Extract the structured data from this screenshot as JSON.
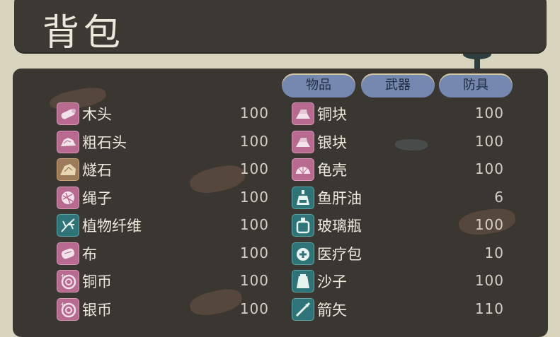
{
  "title": "背包",
  "tabs": [
    {
      "label": "物品"
    },
    {
      "label": "武器"
    },
    {
      "label": "防具"
    }
  ],
  "inventory": {
    "left": [
      {
        "name": "木头",
        "qty": "100",
        "icon": "log-icon",
        "color": "pink"
      },
      {
        "name": "粗石头",
        "qty": "100",
        "icon": "rough-stone-icon",
        "color": "pink"
      },
      {
        "name": "燧石",
        "qty": "100",
        "icon": "flint-icon",
        "color": "tan"
      },
      {
        "name": "绳子",
        "qty": "100",
        "icon": "rope-icon",
        "color": "pink"
      },
      {
        "name": "植物纤维",
        "qty": "100",
        "icon": "plant-fiber-icon",
        "color": "teal"
      },
      {
        "name": "布",
        "qty": "100",
        "icon": "cloth-icon",
        "color": "pink"
      },
      {
        "name": "铜币",
        "qty": "100",
        "icon": "copper-coin-icon",
        "color": "pink"
      },
      {
        "name": "银币",
        "qty": "100",
        "icon": "silver-coin-icon",
        "color": "pink"
      }
    ],
    "right": [
      {
        "name": "铜块",
        "qty": "100",
        "icon": "copper-ingot-icon",
        "color": "pink"
      },
      {
        "name": "银块",
        "qty": "100",
        "icon": "silver-ingot-icon",
        "color": "pink"
      },
      {
        "name": "龟壳",
        "qty": "100",
        "icon": "shell-icon",
        "color": "pink"
      },
      {
        "name": "鱼肝油",
        "qty": "6",
        "icon": "oil-bottle-icon",
        "color": "teal"
      },
      {
        "name": "玻璃瓶",
        "qty": "100",
        "icon": "glass-bottle-icon",
        "color": "teal"
      },
      {
        "name": "医疗包",
        "qty": "10",
        "icon": "medkit-icon",
        "color": "teal"
      },
      {
        "name": "沙子",
        "qty": "100",
        "icon": "sand-bag-icon",
        "color": "teal"
      },
      {
        "name": "箭矢",
        "qty": "110",
        "icon": "arrow-icon",
        "color": "teal"
      }
    ]
  },
  "colors": {
    "panel": "#3a3631",
    "background": "#d8d4bd",
    "tab": "#7488b0",
    "icon_pink": "#b86a90",
    "icon_teal": "#2f7478",
    "icon_tan": "#9c7a5a"
  }
}
